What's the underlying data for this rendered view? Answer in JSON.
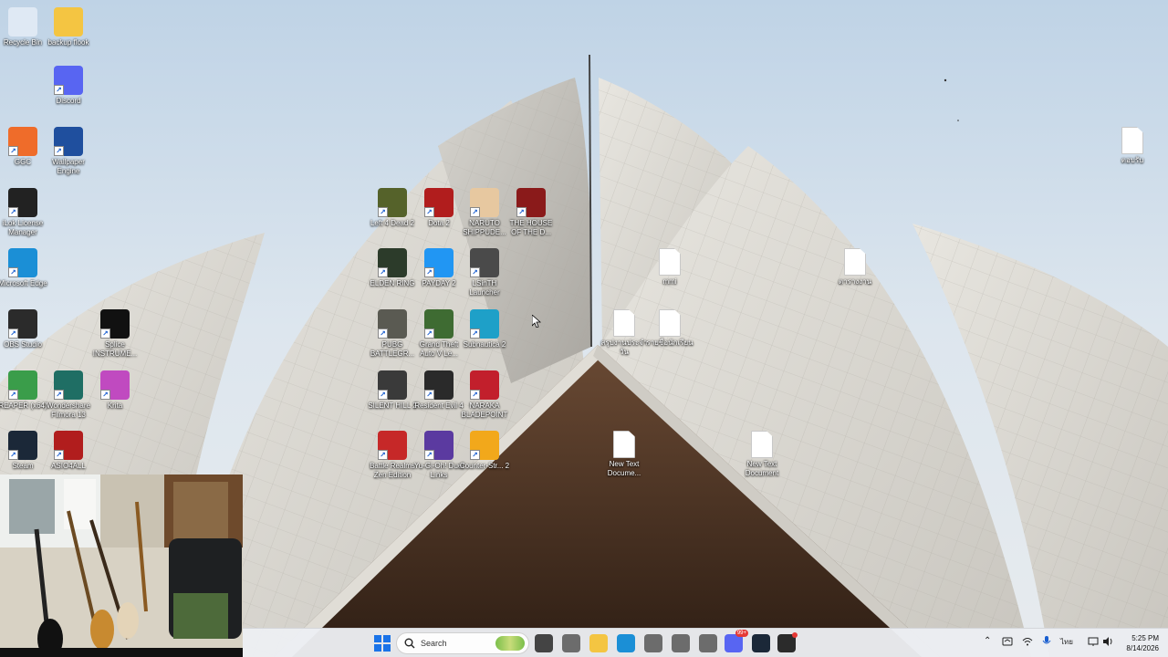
{
  "desktop": {
    "icons_left": [
      {
        "label": "Recycle Bin",
        "icon": "recycle-bin-icon",
        "color": "#dfe9f4"
      },
      {
        "label": "backup flook",
        "icon": "folder-icon",
        "color": "#f4c542"
      },
      {
        "label": "Discord",
        "icon": "discord-icon",
        "color": "#5865f2"
      },
      {
        "label": "GGC",
        "icon": "ggc-icon",
        "color": "#ef6c2a"
      },
      {
        "label": "Wallpaper Engine",
        "icon": "wallpaper-engine-icon",
        "color": "#1f4f9e"
      },
      {
        "label": "iLok License Manager",
        "icon": "ilok-icon",
        "color": "#222222"
      },
      {
        "label": "Microsoft Edge",
        "icon": "edge-icon",
        "color": "#1b8fd6"
      },
      {
        "label": "OBS Studio",
        "icon": "obs-icon",
        "color": "#2b2b2b"
      },
      {
        "label": "Splice INSTRUME...",
        "icon": "splice-icon",
        "color": "#111111"
      },
      {
        "label": "REAPER (x64)",
        "icon": "reaper-icon",
        "color": "#3a9d4a"
      },
      {
        "label": "Wondershare Filmora 13",
        "icon": "filmora-icon",
        "color": "#1f6e64"
      },
      {
        "label": "Krita",
        "icon": "krita-icon",
        "color": "#c04ac0"
      },
      {
        "label": "Steam",
        "icon": "steam-icon",
        "color": "#1b2838"
      },
      {
        "label": "ASIO4ALL",
        "icon": "asio4all-icon",
        "color": "#b11d1d"
      }
    ],
    "game_icons": [
      {
        "label": "Left 4 Dead 2",
        "icon": "left4dead2-icon",
        "color": "#55622a"
      },
      {
        "label": "Dota 2",
        "icon": "dota2-icon",
        "color": "#b11d1d"
      },
      {
        "label": "NARUTO SHIPPUDE...",
        "icon": "naruto-icon",
        "color": "#e7c8a0"
      },
      {
        "label": "THE HOUSE OF THE D...",
        "icon": "house-of-the-dead-icon",
        "color": "#8a1a1a"
      },
      {
        "label": "ELDEN RING",
        "icon": "elden-ring-icon",
        "color": "#2c3b2a"
      },
      {
        "label": "PAYDAY 2",
        "icon": "payday2-icon",
        "color": "#2196f3"
      },
      {
        "label": "LSinTH Launcher",
        "icon": "lsinth-launcher-icon",
        "color": "#4a4a4a"
      },
      {
        "label": "PUBG BATTLEGR...",
        "icon": "pubg-icon",
        "color": "#5a5a52"
      },
      {
        "label": "Grand Theft Auto V Le...",
        "icon": "gta5-icon",
        "color": "#3e6b32"
      },
      {
        "label": "Subnautica 2",
        "icon": "subnautica2-icon",
        "color": "#1ea0c8"
      },
      {
        "label": "SILENT HILL 2",
        "icon": "silent-hill-2-icon",
        "color": "#3a3a3a"
      },
      {
        "label": "Resident Evil 4",
        "icon": "resident-evil-4-icon",
        "color": "#2a2a2a"
      },
      {
        "label": "NARAKA BLADEPOINT",
        "icon": "naraka-icon",
        "color": "#c21f2c"
      },
      {
        "label": "Battle Realms Zen Edition",
        "icon": "battle-realms-icon",
        "color": "#c62828"
      },
      {
        "label": "Yu-Gi-Oh! Duel Links",
        "icon": "yugioh-icon",
        "color": "#5b3aa0"
      },
      {
        "label": "Counter-Str... 2",
        "icon": "counter-strike-2-icon",
        "color": "#f2a81b"
      }
    ],
    "files": [
      {
        "label": "mmi",
        "icon": "text-file-icon"
      },
      {
        "label": "ตารางงาน",
        "icon": "text-file-icon"
      },
      {
        "label": "สรุปงานประจำวัน",
        "icon": "text-file-icon"
      },
      {
        "label": "รายชื่อนักเรียน",
        "icon": "text-file-icon"
      },
      {
        "label": "New Text Docume...",
        "icon": "text-file-icon"
      },
      {
        "label": "New Text Document",
        "icon": "text-file-icon"
      },
      {
        "label": "ตอบรับ",
        "icon": "text-file-icon"
      }
    ]
  },
  "taskbar": {
    "search_placeholder": "Search",
    "apps": [
      {
        "name": "start-button",
        "color": "#1a73e8"
      },
      {
        "name": "task-view",
        "color": "#444444"
      },
      {
        "name": "app-gray-1",
        "color": "#6c6c6c"
      },
      {
        "name": "file-explorer",
        "color": "#f4c542"
      },
      {
        "name": "edge",
        "color": "#1b8fd6"
      },
      {
        "name": "app-gray-2",
        "color": "#6c6c6c"
      },
      {
        "name": "app-gray-3",
        "color": "#6c6c6c"
      },
      {
        "name": "app-gray-4",
        "color": "#6c6c6c"
      },
      {
        "name": "discord",
        "color": "#5865f2"
      },
      {
        "name": "steam",
        "color": "#1b2838"
      },
      {
        "name": "obs",
        "color": "#2b2b2b"
      }
    ],
    "discord_badge": "99+",
    "tray_language": "ไทย",
    "clock_time": "5:25 PM",
    "clock_date": "8/14/2026"
  }
}
